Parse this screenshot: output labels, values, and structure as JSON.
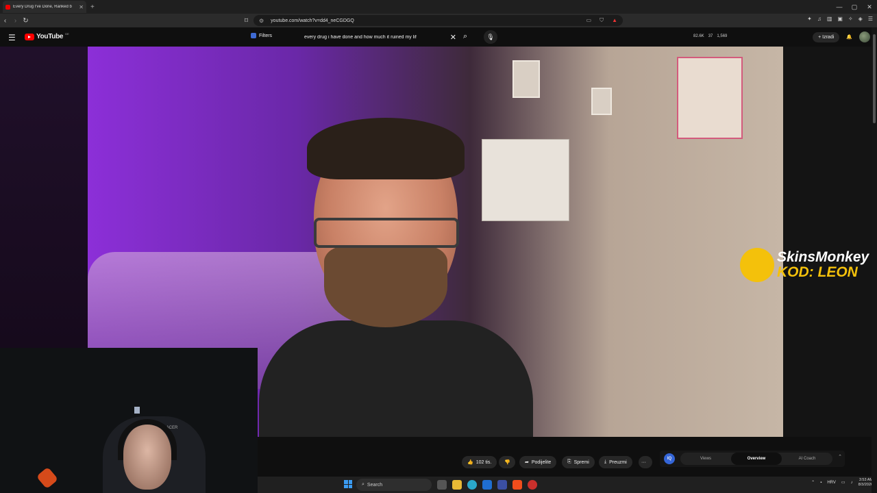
{
  "browser": {
    "tab_title": "Every Drug I've Done, Ranked b",
    "tab_close": "✕",
    "new_tab": "+",
    "window_controls": [
      "—",
      "▢",
      "✕"
    ],
    "url": "youtube.com/watch?v=dd4_neCGDGQ"
  },
  "youtube": {
    "logo_text": "YouTube",
    "country_code": "DE",
    "filters_label": "Filters",
    "search_query": "every drug i have done and how much it ruined my lif",
    "stats": [
      "82.6K",
      "37",
      "1,569"
    ],
    "create_label": "Izradi"
  },
  "video": {
    "sponsor_line1": "SkinsMonkey",
    "sponsor_line2": "KOD: LEON"
  },
  "webcam": {
    "chair_logo": "DXRACER"
  },
  "actions": {
    "like_count": "102 tis.",
    "share_label": "Podijelite",
    "save_label": "Spremi",
    "download_label": "Preuzmi",
    "more_label": "···"
  },
  "coach": {
    "badge": "IQ",
    "tabs": [
      "Views",
      "Overview",
      "AI Coach"
    ],
    "active_tab": "Overview"
  },
  "taskbar": {
    "search_label": "Search",
    "language": "HRV",
    "time": "3:53 AM",
    "date": "8/3/2026"
  },
  "colors": {
    "youtube_red": "#ff0000",
    "sponsor_yellow": "#f4c10b",
    "coach_blue": "#3465d7",
    "windows_blue": "#3b9cf2"
  }
}
